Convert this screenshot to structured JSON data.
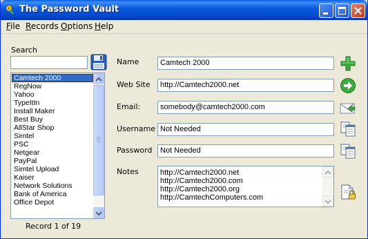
{
  "window": {
    "title": "The Password Vault"
  },
  "menu": [
    {
      "label": "File",
      "underline": "F",
      "rest": "ile"
    },
    {
      "label": "Records",
      "underline": "R",
      "rest": "ecords"
    },
    {
      "label": "Options",
      "underline": "O",
      "rest": "ptions"
    },
    {
      "label": "Help",
      "underline": "H",
      "rest": "elp"
    }
  ],
  "search": {
    "label": "Search",
    "value": ""
  },
  "list": {
    "items": [
      "Camtech 2000",
      "RegNow",
      "Yahoo",
      "TypeItIn",
      "Install Maker",
      "Best Buy",
      "AllStar Shop",
      "Simtel",
      "PSC",
      "Netgear",
      "PayPal",
      "Simtel Upload",
      "Kaiser",
      "Network Solutions",
      "Bank of America",
      "Office Depot"
    ],
    "selected": "Camtech 2000"
  },
  "record_status": "Record 1 of 19",
  "form": {
    "name_label": "Name",
    "name_value": "Camtech 2000",
    "website_label": "Web Site",
    "website_value": "http://Camtech2000.net",
    "email_label": "Email:",
    "email_value": "somebody@camtech2000.com",
    "username_label": "Username",
    "username_value": "Not Needed",
    "password_label": "Password",
    "password_value": "Not Needed",
    "notes_label": "Notes",
    "notes_lines": [
      "http://Camtech2000.net",
      "http://Camtech2000.com",
      "http://Camtech2000.org",
      "http://CamtechComputers.com"
    ]
  },
  "icons": {
    "save": "floppy-disk-icon",
    "add": "plus-icon",
    "go": "arrow-right-icon",
    "email": "envelope-icon",
    "copy": "copy-icon",
    "notes": "lock-document-icon"
  }
}
